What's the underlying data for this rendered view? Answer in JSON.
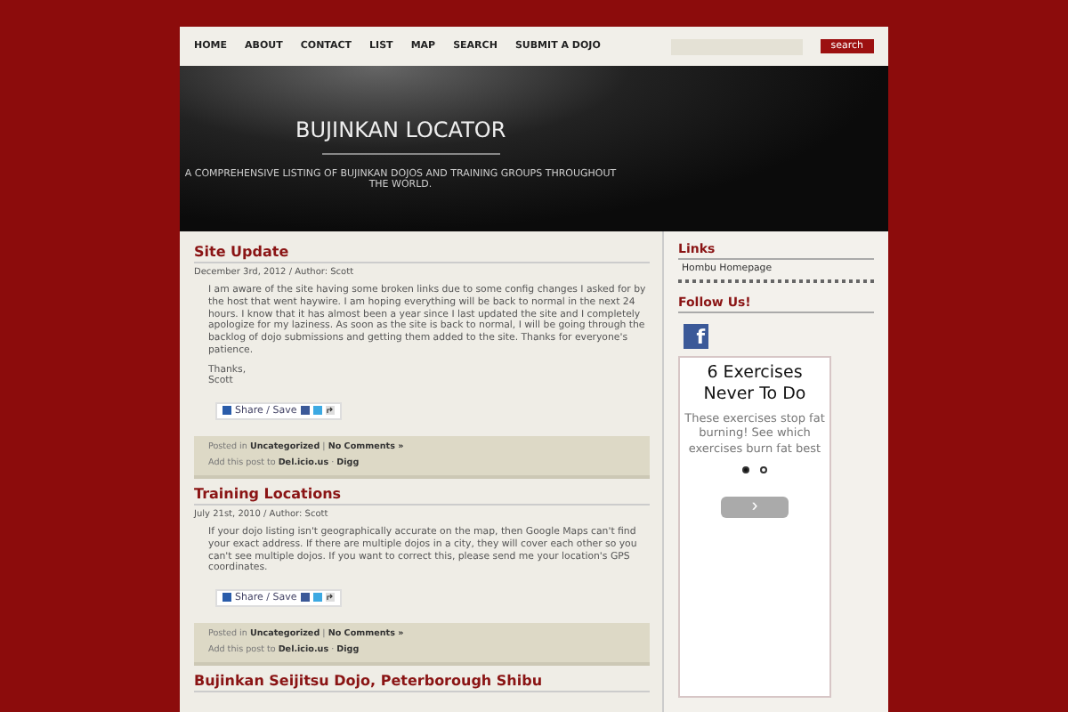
{
  "nav": {
    "items": [
      "HOME",
      "ABOUT",
      "CONTACT",
      "LIST",
      "MAP",
      "SEARCH",
      "SUBMIT A DOJO"
    ],
    "search_button": "search"
  },
  "header": {
    "title": "BUJINKAN LOCATOR",
    "tagline": "A COMPREHENSIVE LISTING OF BUJINKAN DOJOS AND TRAINING GROUPS THROUGHOUT THE WORLD."
  },
  "posts": [
    {
      "title": "Site Update",
      "meta": "December 3rd, 2012  / Author: Scott",
      "paragraphs": [
        "I am aware of the site having some broken links due to some config changes I asked for by the host that went haywire. I am hoping everything will be back to normal in the next 24 hours. I know that it has almost been a year since I last updated the site and I completely apologize for my laziness. As soon as the site is back to normal, I will be going through the backlog of dojo submissions and getting them added to the site. Thanks for everyone's patience.",
        "Thanks,\nScott"
      ],
      "share": "Share / Save",
      "posted_in": "Posted in",
      "category": "Uncategorized",
      "comments": "No Comments »",
      "sep1": "|",
      "add_label": "Add this post to",
      "delicious": "Del.icio.us",
      "sep2": "·",
      "digg": "Digg"
    },
    {
      "title": "Training Locations",
      "meta": "July 21st, 2010  / Author: Scott",
      "paragraphs": [
        "If your dojo listing isn't geographically accurate on the map, then Google Maps can't find your exact address. If there are multiple dojos in a city, they will cover each other so you can't see multiple dojos. If you want to correct this, please send me your location's GPS coordinates."
      ],
      "share": "Share / Save",
      "posted_in": "Posted in",
      "category": "Uncategorized",
      "comments": "No Comments »",
      "sep1": "|",
      "add_label": "Add this post to",
      "delicious": "Del.icio.us",
      "sep2": "·",
      "digg": "Digg"
    },
    {
      "title": "Bujinkan Seijitsu Dojo, Peterborough Shibu"
    }
  ],
  "sidebar": {
    "links_title": "Links",
    "links": [
      "Hombu Homepage"
    ],
    "follow_title": "Follow Us!",
    "facebook": "f",
    "ad": {
      "title": "6 Exercises Never To Do",
      "body": "These exercises stop fat burning! See which exercises burn fat best",
      "dots": [
        {
          "selected": true
        },
        {
          "selected": false
        }
      ],
      "next": "›"
    }
  }
}
